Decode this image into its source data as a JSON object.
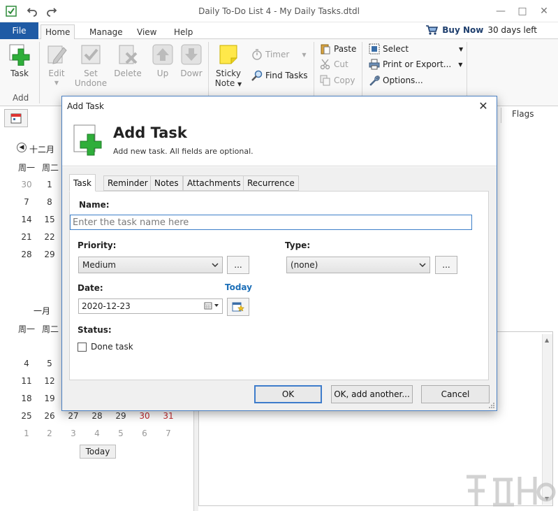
{
  "window": {
    "title": "Daily To-Do List 4 - My Daily Tasks.dtdl",
    "buy_now": "Buy Now",
    "trial": "30 days left"
  },
  "ribbon": {
    "file_tab": "File",
    "tabs": [
      "Home",
      "Manage",
      "View",
      "Help"
    ],
    "add_group": {
      "task": "Task",
      "label": "Add"
    },
    "edit": "Edit",
    "set_undone": [
      "Set",
      "Undone"
    ],
    "delete": "Delete",
    "up": "Up",
    "down": "Dowr",
    "sticky_note": [
      "Sticky",
      "Note"
    ],
    "timer": "Timer",
    "find_tasks": "Find Tasks",
    "paste": "Paste",
    "cut": "Cut",
    "copy": "Copy",
    "select": "Select",
    "print_export": "Print or Export...",
    "options": "Options..."
  },
  "calendar": {
    "month1": "十二月",
    "month2": "一月",
    "weekdays": [
      "周一",
      "周二"
    ],
    "month1_rows": [
      [
        "30",
        "1"
      ],
      [
        "7",
        "8"
      ],
      [
        "14",
        "15"
      ],
      [
        "21",
        "22"
      ],
      [
        "28",
        "29"
      ]
    ],
    "month2_rows": [
      [
        "4",
        "5"
      ],
      [
        "11",
        "12"
      ],
      [
        "18",
        "19"
      ]
    ],
    "month2_last_row": [
      "25",
      "26",
      "27",
      "28",
      "29",
      "30",
      "31"
    ],
    "month2_next_row": [
      "1",
      "2",
      "3",
      "4",
      "5",
      "6",
      "7"
    ],
    "today": "Today"
  },
  "right_pane": {
    "flags_header": "Flags"
  },
  "dialog": {
    "title": "Add Task",
    "heading": "Add Task",
    "subheading": "Add new task. All fields are optional.",
    "tabs": [
      "Task",
      "Reminder",
      "Notes",
      "Attachments",
      "Recurrence"
    ],
    "name_label": "Name:",
    "name_placeholder": "Enter the task name here",
    "priority_label": "Priority:",
    "priority_value": "Medium",
    "type_label": "Type:",
    "type_value": "(none)",
    "ellipsis": "...",
    "date_label": "Date:",
    "today_link": "Today",
    "date_value": "2020-12-23",
    "status_label": "Status:",
    "done_label": "Done task",
    "ok": "OK",
    "ok_another": "OK, add another...",
    "cancel": "Cancel"
  },
  "colors": {
    "accent": "#1f5ba5",
    "link": "#1c6fb8",
    "weekend_red": "#c0282d",
    "add_green": "#2fae3a"
  }
}
